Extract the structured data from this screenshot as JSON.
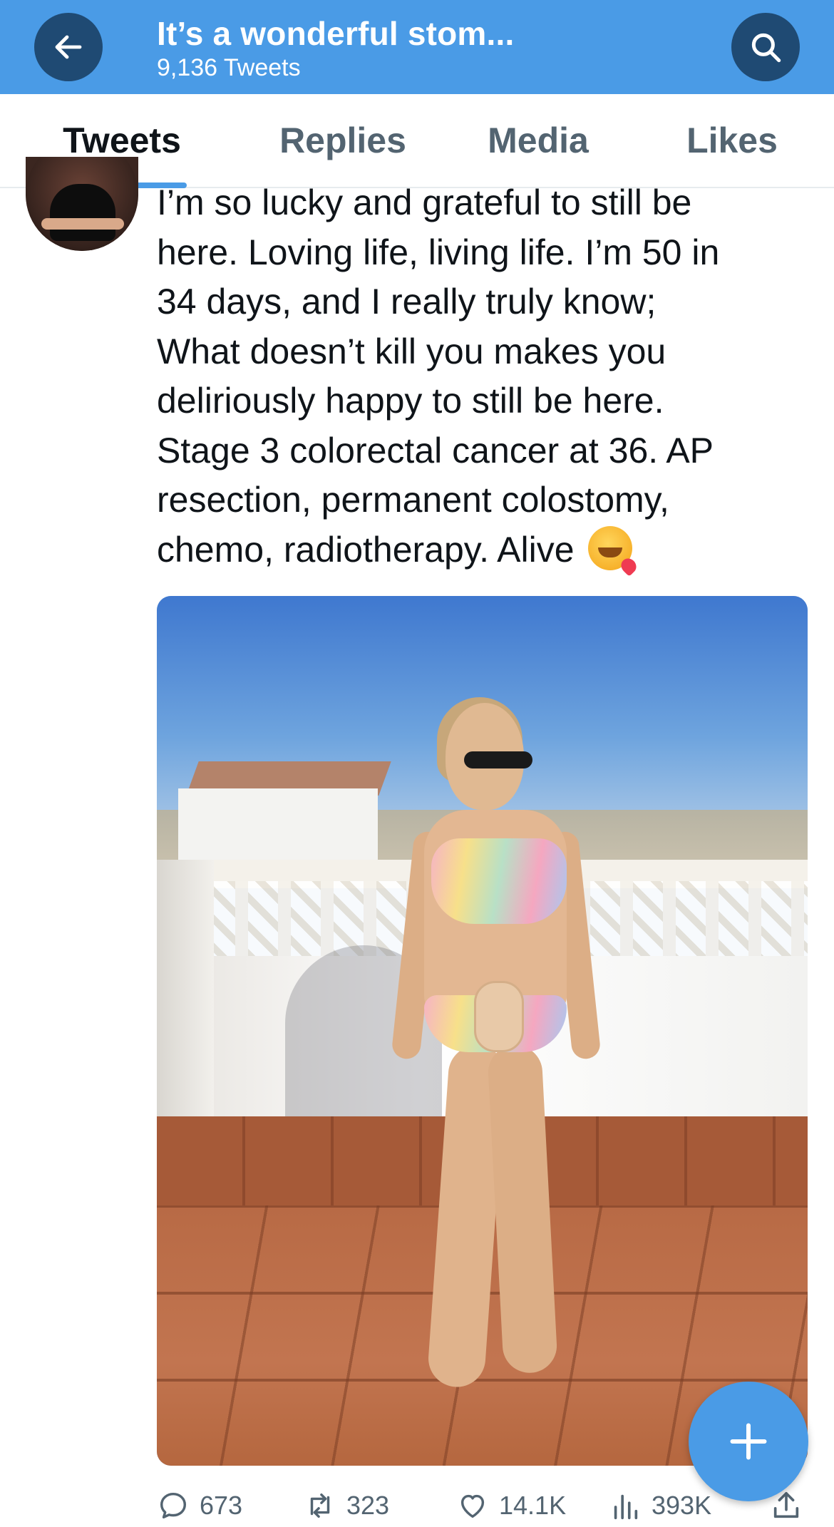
{
  "colors": {
    "accent": "#4a9be6",
    "header_button_bg": "#1f4a73",
    "muted_text": "#536471"
  },
  "header": {
    "back_icon": "arrow-left-icon",
    "title": "It’s a wonderful stom...",
    "subtitle": "9,136 Tweets",
    "search_icon": "search-icon"
  },
  "tabs": [
    {
      "label": "Tweets",
      "active": true
    },
    {
      "label": "Replies",
      "active": false
    },
    {
      "label": "Media",
      "active": false
    },
    {
      "label": "Likes",
      "active": false
    }
  ],
  "tweet": {
    "text_lines": [
      "I’m so lucky and grateful to still be",
      "here. Loving life, living life. I’m 50 in",
      "34 days, and I really truly know;",
      "What doesn’t kill you makes you",
      "deliriously happy to still be here.",
      "Stage 3 colorectal cancer at 36. AP",
      "resection, permanent colostomy,",
      "chemo, radiotherapy. Alive"
    ],
    "emoji": "smiling-face-with-hearts-emoji",
    "actions": {
      "replies": "673",
      "retweets": "323",
      "likes": "14.1K",
      "views": "393K"
    }
  },
  "fab": {
    "icon": "plus-icon"
  }
}
